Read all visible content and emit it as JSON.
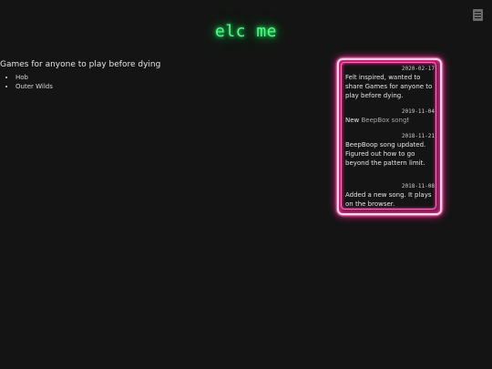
{
  "header": {
    "title": "elc me",
    "menu_icon": "menu-icon"
  },
  "main": {
    "heading": "Games for anyone to play before dying",
    "games": [
      "Hob",
      "Outer Wilds"
    ]
  },
  "news": {
    "items": [
      {
        "date": "2020-02-17",
        "text": "Felt inspired, wanted to share Games for anyone to play before dying."
      },
      {
        "date": "2019-11-04",
        "prefix": "New ",
        "link": "BeepBox song",
        "suffix": "!"
      },
      {
        "date": "2018-11-21",
        "text": "BeepBoop song updated. Figured out how to go beyond the pattern limit."
      },
      {
        "date": "2018-11-08",
        "text": "Added a new song. It plays on the browser."
      }
    ]
  },
  "colors": {
    "background": "#141414",
    "title_neon": "#4dff8a",
    "frame_neon": "#ff1f8f"
  }
}
